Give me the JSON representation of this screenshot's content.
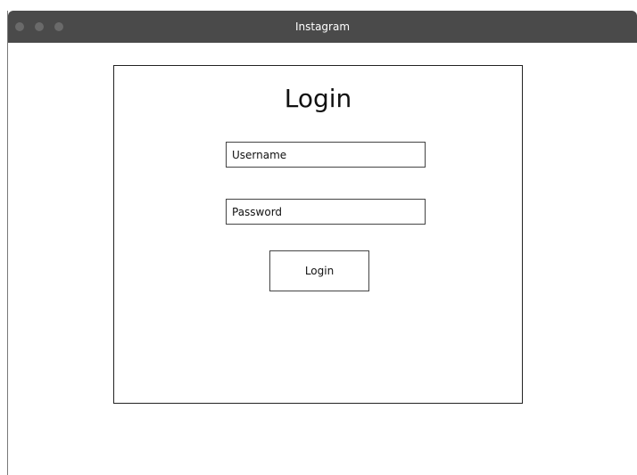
{
  "window": {
    "title": "Instagram",
    "titlebar_color": "#4a4a4a",
    "traffic_light_color": "#6a6a6a"
  },
  "login": {
    "heading": "Login",
    "username_placeholder": "Username",
    "username_value": "",
    "password_placeholder": "Password",
    "password_value": "",
    "button_label": "Login"
  }
}
